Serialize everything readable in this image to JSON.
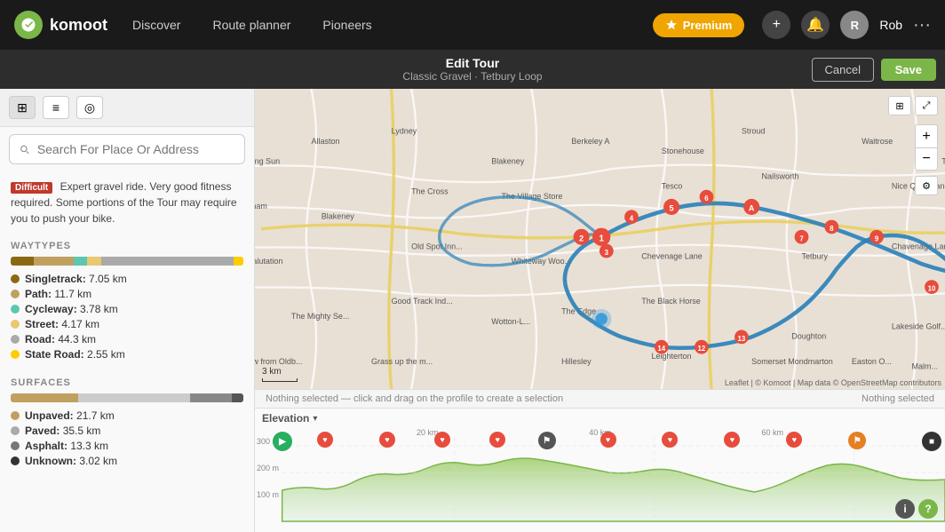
{
  "app": {
    "name": "komoot",
    "logo_letter": "k"
  },
  "header": {
    "nav": [
      "Discover",
      "Route planner",
      "Pioneers"
    ],
    "premium_label": "Premium",
    "add_icon": "+",
    "username": "Rob",
    "more_icon": "···"
  },
  "edit_bar": {
    "title": "Edit Tour",
    "subtitle": "Classic Gravel · Tetbury Loop",
    "cancel_label": "Cancel",
    "save_label": "Save"
  },
  "search": {
    "placeholder": "Search For Place Or Address"
  },
  "description": {
    "difficulty": "Difficult",
    "text": "Expert gravel ride. Very good fitness required. Some portions of the Tour may require you to push your bike."
  },
  "waytypes": {
    "title": "WAYTYPES",
    "items": [
      {
        "label": "Singletrack:",
        "value": "7.05 km",
        "color": "#8B6914"
      },
      {
        "label": "Path:",
        "value": "11.7 km",
        "color": "#c0a060"
      },
      {
        "label": "Cycleway:",
        "value": "3.78 km",
        "color": "#5bc8af"
      },
      {
        "label": "Street:",
        "value": "4.17 km",
        "color": "#e8c870"
      },
      {
        "label": "Road:",
        "value": "44.3 km",
        "color": "#aaaaaa"
      },
      {
        "label": "State Road:",
        "value": "2.55 km",
        "color": "#ffcc00"
      }
    ],
    "bar_segments": [
      {
        "width": "10%",
        "color": "#8B6914"
      },
      {
        "width": "17%",
        "color": "#c0a060"
      },
      {
        "width": "6%",
        "color": "#5bc8af"
      },
      {
        "width": "6%",
        "color": "#e8c870"
      },
      {
        "width": "57%",
        "color": "#aaaaaa"
      },
      {
        "width": "4%",
        "color": "#ffcc00"
      }
    ]
  },
  "surfaces": {
    "title": "SURFACES",
    "items": [
      {
        "label": "Unpaved:",
        "value": "21.7 km",
        "color": "#c0a060"
      },
      {
        "label": "Paved:",
        "value": "35.5 km",
        "color": "#aaaaaa"
      },
      {
        "label": "Asphalt:",
        "value": "13.3 km",
        "color": "#777777"
      },
      {
        "label": "Unknown:",
        "value": "3.02 km",
        "color": "#333333"
      }
    ],
    "bar_segments": [
      {
        "width": "29%",
        "color": "#c0a060"
      },
      {
        "width": "48%",
        "color": "#cccccc"
      },
      {
        "width": "18%",
        "color": "#888888"
      },
      {
        "width": "5%",
        "color": "#555555"
      }
    ]
  },
  "map": {
    "zoom_in": "+",
    "zoom_out": "−",
    "scale_label": "3 km",
    "attribution": "Leaflet | © Komoot | Map data © OpenStreetMap contributors"
  },
  "elevation": {
    "title": "Elevation",
    "nothing_selected_left": "Nothing selected — click and drag on the profile to create a selection",
    "nothing_selected_right": "Nothing selected",
    "distance_markers": [
      "20 km",
      "40 km",
      "60 km"
    ],
    "y_labels": [
      "300 m",
      "200 m",
      "100 m"
    ]
  }
}
